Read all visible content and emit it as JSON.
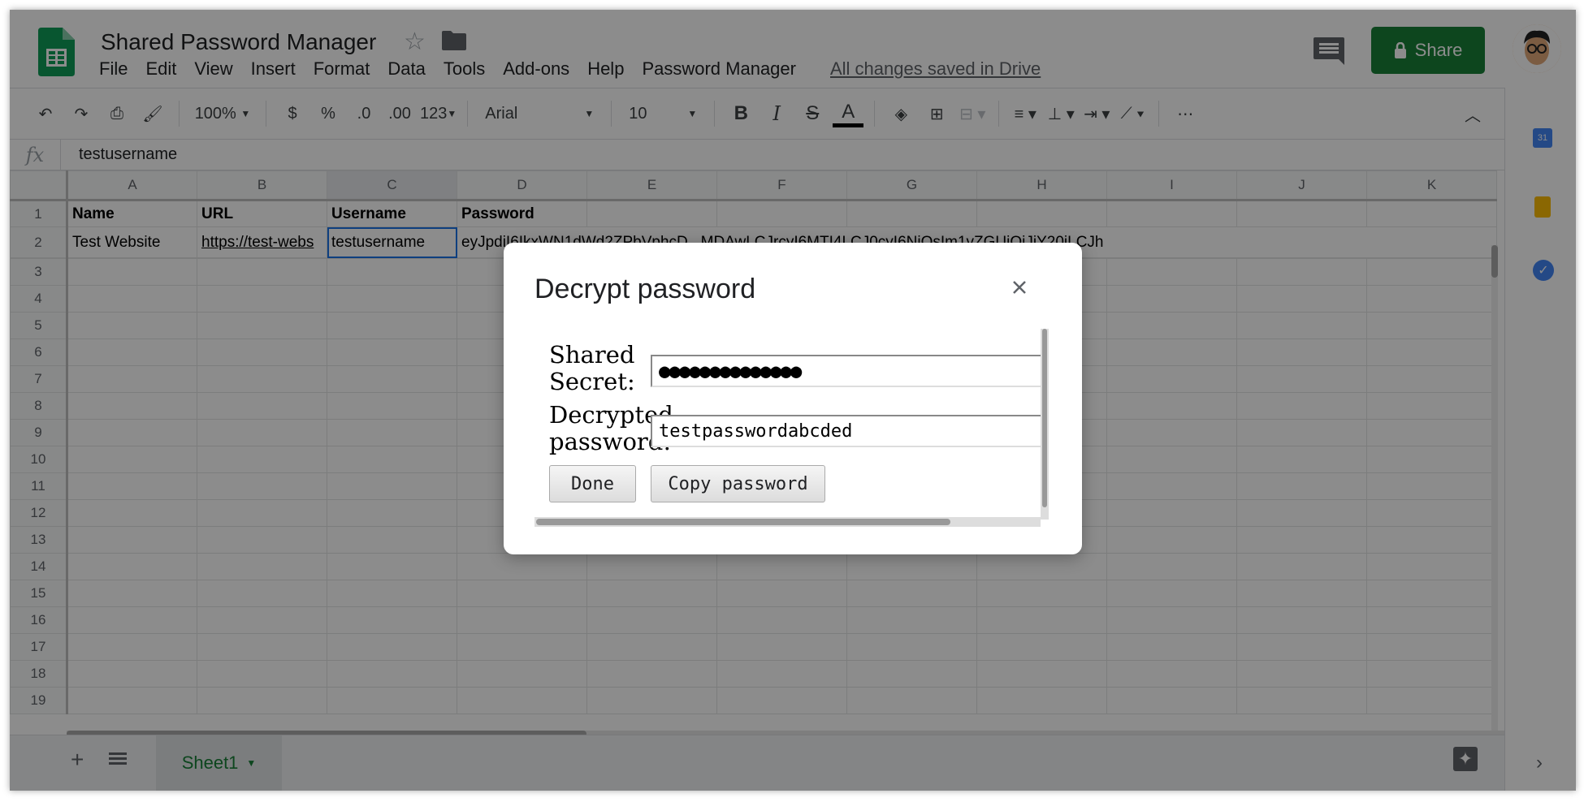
{
  "app": {
    "title": "Shared Password Manager",
    "saved_status": "All changes saved in Drive",
    "share_label": "Share"
  },
  "menu": [
    "File",
    "Edit",
    "View",
    "Insert",
    "Format",
    "Data",
    "Tools",
    "Add-ons",
    "Help",
    "Password Manager"
  ],
  "toolbar": {
    "zoom": "100%",
    "currency": "$",
    "percent": "%",
    "dec_decrease": ".0",
    "dec_increase": ".00",
    "format_more": "123",
    "font": "Arial",
    "font_size": "10",
    "bold": "B",
    "italic": "I",
    "strike": "S",
    "text_color": "A"
  },
  "formula_bar": {
    "fx": "fx",
    "value": "testusername"
  },
  "grid": {
    "columns": [
      "A",
      "B",
      "C",
      "D",
      "E",
      "F",
      "G",
      "H",
      "I",
      "J",
      "K"
    ],
    "rows": [
      {
        "num": "1",
        "cells": [
          "Name",
          "URL",
          "Username",
          "Password",
          "",
          "",
          "",
          "",
          "",
          "",
          ""
        ]
      },
      {
        "num": "2",
        "cells": [
          "Test Website",
          "https://test-webs",
          "testusername",
          "eyJpdiI6IkxWN1dWd2ZPbVphcD...MDAwLCJrcyI6MTI4LCJ0cyI6NjQsIm1vZGUiOiJjY20iLCJh",
          "",
          "",
          "",
          "",
          "",
          "",
          ""
        ]
      },
      {
        "num": "3",
        "cells": [
          "",
          "",
          "",
          "",
          "",
          "",
          "",
          "",
          "",
          "",
          ""
        ]
      },
      {
        "num": "4",
        "cells": [
          "",
          "",
          "",
          "",
          "",
          "",
          "",
          "",
          "",
          "",
          ""
        ]
      },
      {
        "num": "5",
        "cells": [
          "",
          "",
          "",
          "",
          "",
          "",
          "",
          "",
          "",
          "",
          ""
        ]
      },
      {
        "num": "6",
        "cells": [
          "",
          "",
          "",
          "",
          "",
          "",
          "",
          "",
          "",
          "",
          ""
        ]
      },
      {
        "num": "7",
        "cells": [
          "",
          "",
          "",
          "",
          "",
          "",
          "",
          "",
          "",
          "",
          ""
        ]
      },
      {
        "num": "8",
        "cells": [
          "",
          "",
          "",
          "",
          "",
          "",
          "",
          "",
          "",
          "",
          ""
        ]
      },
      {
        "num": "9",
        "cells": [
          "",
          "",
          "",
          "",
          "",
          "",
          "",
          "",
          "",
          "",
          ""
        ]
      },
      {
        "num": "10",
        "cells": [
          "",
          "",
          "",
          "",
          "",
          "",
          "",
          "",
          "",
          "",
          ""
        ]
      },
      {
        "num": "11",
        "cells": [
          "",
          "",
          "",
          "",
          "",
          "",
          "",
          "",
          "",
          "",
          ""
        ]
      },
      {
        "num": "12",
        "cells": [
          "",
          "",
          "",
          "",
          "",
          "",
          "",
          "",
          "",
          "",
          ""
        ]
      },
      {
        "num": "13",
        "cells": [
          "",
          "",
          "",
          "",
          "",
          "",
          "",
          "",
          "",
          "",
          ""
        ]
      },
      {
        "num": "14",
        "cells": [
          "",
          "",
          "",
          "",
          "",
          "",
          "",
          "",
          "",
          "",
          ""
        ]
      },
      {
        "num": "15",
        "cells": [
          "",
          "",
          "",
          "",
          "",
          "",
          "",
          "",
          "",
          "",
          ""
        ]
      },
      {
        "num": "16",
        "cells": [
          "",
          "",
          "",
          "",
          "",
          "",
          "",
          "",
          "",
          "",
          ""
        ]
      },
      {
        "num": "17",
        "cells": [
          "",
          "",
          "",
          "",
          "",
          "",
          "",
          "",
          "",
          "",
          ""
        ]
      },
      {
        "num": "18",
        "cells": [
          "",
          "",
          "",
          "",
          "",
          "",
          "",
          "",
          "",
          "",
          ""
        ]
      },
      {
        "num": "19",
        "cells": [
          "",
          "",
          "",
          "",
          "",
          "",
          "",
          "",
          "",
          "",
          ""
        ]
      }
    ]
  },
  "sheet_tab": "Sheet1",
  "dialog": {
    "title": "Decrypt password",
    "secret_label_1": "Shared",
    "secret_label_2": "Secret:",
    "secret_value": "●●●●●●●●●●●●●●",
    "decrypted_label_1": "Decrypted",
    "decrypted_label_2": "password:",
    "decrypted_value": "testpasswordabcded",
    "done_label": "Done",
    "copy_label": "Copy password"
  },
  "colors": {
    "brand_green": "#188038",
    "link_blue": "#1155cc",
    "selection_blue": "#1a73e8"
  }
}
